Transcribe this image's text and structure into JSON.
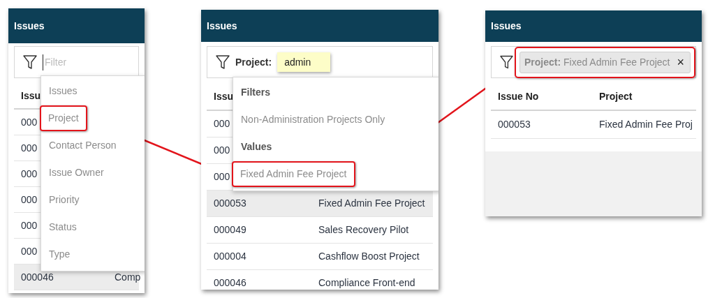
{
  "panels": [
    {
      "title": "Issues",
      "filter": {
        "kind": "empty",
        "placeholder": "Filter"
      },
      "table": {
        "columns": [
          "Issu"
        ],
        "rows": [
          {
            "cells": [
              "000"
            ],
            "selected": false
          },
          {
            "cells": [
              "000"
            ],
            "selected": false
          },
          {
            "cells": [
              "000"
            ],
            "selected": false
          },
          {
            "cells": [
              "000"
            ],
            "selected": false
          },
          {
            "cells": [
              "000"
            ],
            "selected": false
          },
          {
            "cells": [
              "000"
            ],
            "selected": false
          },
          {
            "cells": [
              "000046",
              "Comp"
            ],
            "selected": true
          }
        ]
      },
      "menu": [
        {
          "kind": "option",
          "label": "Issues",
          "highlighted": false
        },
        {
          "kind": "option",
          "label": "Project",
          "highlighted": true
        },
        {
          "kind": "option",
          "label": "Contact Person",
          "highlighted": false
        },
        {
          "kind": "option",
          "label": "Issue Owner",
          "highlighted": false
        },
        {
          "kind": "option",
          "label": "Priority",
          "highlighted": false
        },
        {
          "kind": "option",
          "label": "Status",
          "highlighted": false
        },
        {
          "kind": "option",
          "label": "Type",
          "highlighted": false
        }
      ]
    },
    {
      "title": "Issues",
      "filter": {
        "kind": "typing",
        "label": "Project:",
        "value": "admin"
      },
      "table": {
        "columns": [
          "Issu"
        ],
        "rows": [
          {
            "cells": [
              "000"
            ],
            "selected": false
          },
          {
            "cells": [
              "000"
            ],
            "selected": false
          },
          {
            "cells": [
              "000"
            ],
            "selected": false
          },
          {
            "cells": [
              "000053",
              "Fixed Admin Fee Project"
            ],
            "selected": true
          },
          {
            "cells": [
              "000049",
              "Sales Recovery Pilot"
            ],
            "selected": false
          },
          {
            "cells": [
              "000004",
              "Cashflow Boost Project"
            ],
            "selected": false
          },
          {
            "cells": [
              "000046",
              "Compliance Front-end"
            ],
            "selected": false
          }
        ]
      },
      "menu": [
        {
          "kind": "heading",
          "label": "Filters"
        },
        {
          "kind": "option",
          "label": "Non-Administration Projects Only",
          "highlighted": false
        },
        {
          "kind": "heading",
          "label": "Values"
        },
        {
          "kind": "option",
          "label": "Fixed Admin Fee Project",
          "highlighted": true
        }
      ]
    },
    {
      "title": "Issues",
      "filter": {
        "kind": "chip",
        "text": "**Project:** Fixed Admin Fee Project",
        "remove": "×",
        "highlighted": true
      },
      "table": {
        "columns": [
          "Issue No",
          "Project"
        ],
        "rows": [
          {
            "cells": [
              "000053",
              "Fixed Admin Fee Proj"
            ],
            "selected": false
          }
        ]
      }
    }
  ]
}
